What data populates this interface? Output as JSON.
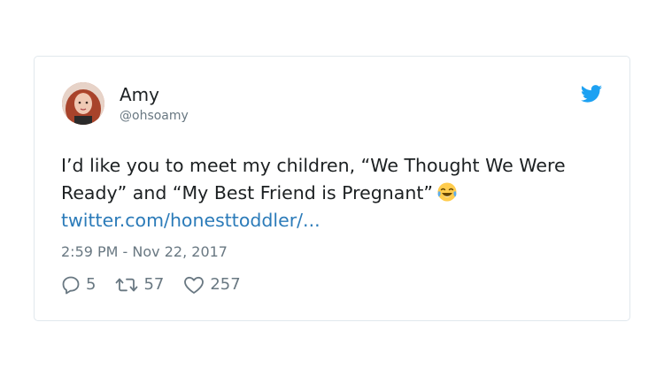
{
  "tweet": {
    "author": {
      "display_name": "Amy",
      "handle": "@ohsoamy",
      "avatar_icon": "user-avatar"
    },
    "brand_icon": "twitter-bird-icon",
    "brand_color": "#1da1f2",
    "text_before_emoji": "I’d like you to meet my children, “We Thought We Were Ready” and “My Best Friend is Pregnant”",
    "emoji": "😂",
    "emoji_icon": "face-with-tears-of-joy-icon",
    "link": "twitter.com/honesttoddler/...",
    "link_color": "#2b7bb9",
    "timestamp": "2:59 PM - Nov 22, 2017"
  },
  "actions": {
    "reply": {
      "icon": "reply-icon",
      "count": "5"
    },
    "retweet": {
      "icon": "retweet-icon",
      "count": "57"
    },
    "like": {
      "icon": "heart-icon",
      "count": "257"
    }
  }
}
